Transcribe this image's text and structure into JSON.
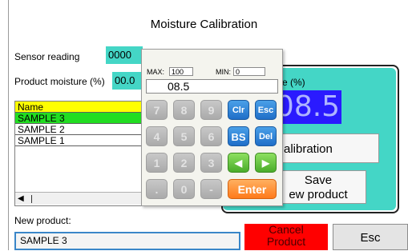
{
  "window": {
    "title": "Moisture Calibration"
  },
  "fields": {
    "sensor_reading": {
      "label": "Sensor reading",
      "value": "0000"
    },
    "product_moisture": {
      "label": "Product moisture (%)",
      "value": "00.0"
    }
  },
  "product_list": {
    "header": "Name",
    "rows": [
      "SAMPLE 3",
      "SAMPLE 2",
      "SAMPLE 1"
    ],
    "selected": "SAMPLE 3",
    "scroll_left_glyph": "◀"
  },
  "calibration_panel": {
    "label_partial": "e (%)",
    "value": "08.5",
    "calibration_button": "alibration",
    "save_button_line1": "Save",
    "save_button_line2": "ew product"
  },
  "new_product": {
    "label": "New product:",
    "value": "SAMPLE 3"
  },
  "buttons": {
    "cancel_line1": "Cancel",
    "cancel_line2": "Product",
    "esc": "Esc"
  },
  "keypad": {
    "max_label": "MAX:",
    "max_value": "100",
    "min_label": "MIN:",
    "min_value": "0",
    "display": "08.5",
    "keys": {
      "k7": "7",
      "k8": "8",
      "k9": "9",
      "clr": "Clr",
      "esc": "Esc",
      "k4": "4",
      "k5": "5",
      "k6": "6",
      "bs": "BS",
      "del": "Del",
      "k1": "1",
      "k2": "2",
      "k3": "3",
      "left": "◀",
      "right": "▶",
      "dot": ".",
      "k0": "0",
      "minus": "-",
      "enter": "Enter"
    }
  },
  "colors": {
    "teal": "#44d6c6",
    "list_header": "#ffff00",
    "list_selected": "#22dd22",
    "value_bg": "#2a1aff",
    "cancel_bg": "#ff0000",
    "key_blue": "#1f6ec8",
    "key_green": "#4aac2a",
    "key_orange": "#ff7a1a"
  }
}
